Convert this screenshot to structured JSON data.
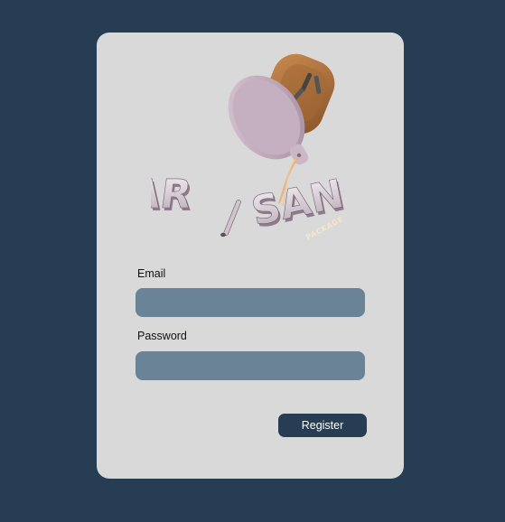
{
  "logo": {
    "text_left": "AR",
    "text_slash": "/",
    "text_right": "SAN",
    "subtitle": "PACKAGE",
    "icon": "artisan-cup-logo-icon"
  },
  "form": {
    "email_label": "Email",
    "email_value": "",
    "password_label": "Password",
    "password_value": "",
    "register_label": "Register"
  },
  "colors": {
    "background": "#263d53",
    "card": "#d9d9d9",
    "input": "#6a8397",
    "button": "#263d53"
  }
}
